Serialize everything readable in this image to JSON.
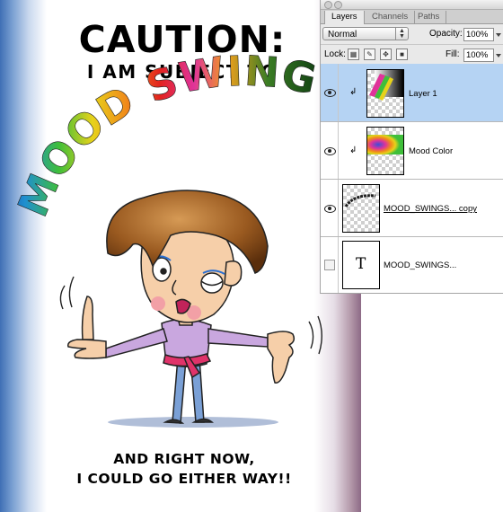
{
  "poster": {
    "heading": "CAUTION:",
    "subheading": "I AM SUBJECT TO",
    "arc_text": "MOOD SWINGS...",
    "footer_line1": "AND RIGHT NOW,",
    "footer_line2": "I COULD GO EITHER WAY!!"
  },
  "panel": {
    "tabs": [
      "Layers",
      "Channels",
      "Paths"
    ],
    "active_tab": "Layers",
    "blend_mode": "Normal",
    "opacity_label": "Opacity:",
    "opacity_value": "100%",
    "lock_label": "Lock:",
    "fill_label": "Fill:",
    "fill_value": "100%",
    "layers": [
      {
        "name": "Layer 1",
        "visible": true,
        "selected": true,
        "clipped": true
      },
      {
        "name": "Mood Color",
        "visible": true,
        "selected": false,
        "clipped": true
      },
      {
        "name": "MOOD_SWINGS... copy",
        "visible": true,
        "selected": false,
        "clipped": false
      },
      {
        "name": "MOOD_SWINGS...",
        "visible": false,
        "selected": false,
        "clipped": false,
        "type_glyph": "T"
      }
    ]
  },
  "colors": {
    "selection": "#b5d3f3",
    "panel_bg": "#e9e9e9",
    "poster_edge_blue": "#3f6fb5",
    "poster_edge_mauve": "#8d6a86"
  },
  "icons": {
    "eye": "eye-icon",
    "clip": "clipping-mask-icon",
    "lock_transparency": "lock-transparency-icon",
    "lock_paint": "lock-paint-icon",
    "lock_move": "lock-move-icon",
    "lock_all": "lock-all-icon"
  }
}
